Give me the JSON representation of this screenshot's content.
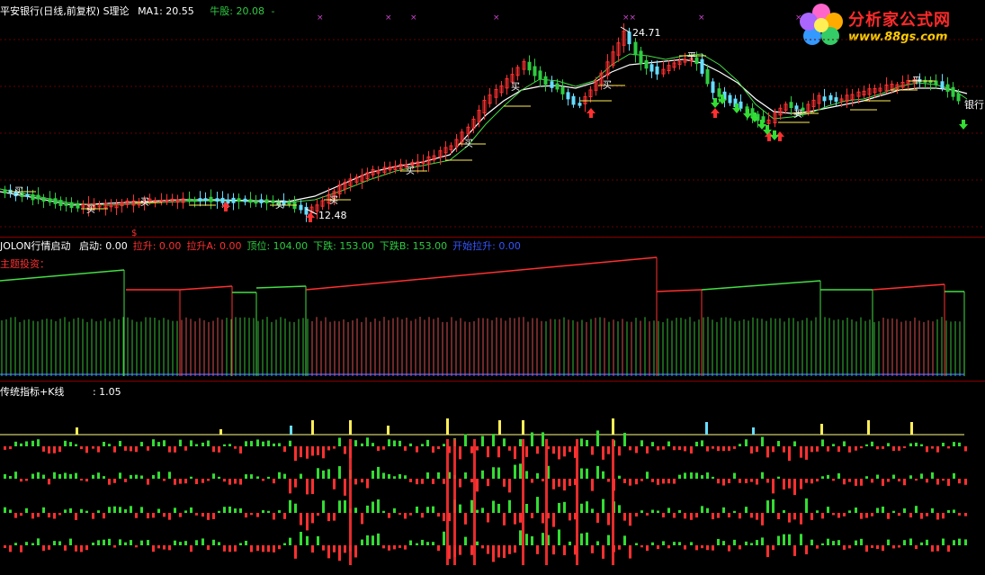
{
  "panel1": {
    "title": "平安银行(日线,前复权) S理论",
    "ma1_label": "MA1: 20.55",
    "ma1_label_suffix": "牛股: 20.08",
    "ma1_dash": "-",
    "high_price": "24.71",
    "low_price": "12.48",
    "stock_name": "银行",
    "buy_marker": "买",
    "sell_marker": "平",
    "dollar_marker": "$",
    "x_marker": "×"
  },
  "panel2": {
    "indicator_name": "JOLON行情启动",
    "values": [
      {
        "text": "启动: 0.00",
        "color": "#ffffff"
      },
      {
        "text": "拉升: 0.00",
        "color": "#ff3030"
      },
      {
        "text": "拉升A: 0.00",
        "color": "#ff3030"
      },
      {
        "text": "顶位: 104.00",
        "color": "#2ecc40"
      },
      {
        "text": "下跌: 153.00",
        "color": "#2ecc40"
      },
      {
        "text": "下跌B: 153.00",
        "color": "#2ecc40"
      },
      {
        "text": "开始拉升: 0.00",
        "color": "#3355ff"
      }
    ],
    "subtitle": "主题投资："
  },
  "panel3": {
    "indicator_name": "传统指标+K线",
    "value": ": 1.05"
  },
  "logo": {
    "title": "分析家公式网",
    "url": "www.88gs.com"
  },
  "colors": {
    "up": "#ff3030",
    "down": "#2ecc40",
    "ma": "#ffffff",
    "ma2": "#ffff66",
    "cyan": "#66ddff",
    "yellow": "#ffee55",
    "magenta": "#cc44cc",
    "blue": "#3355ff"
  }
}
